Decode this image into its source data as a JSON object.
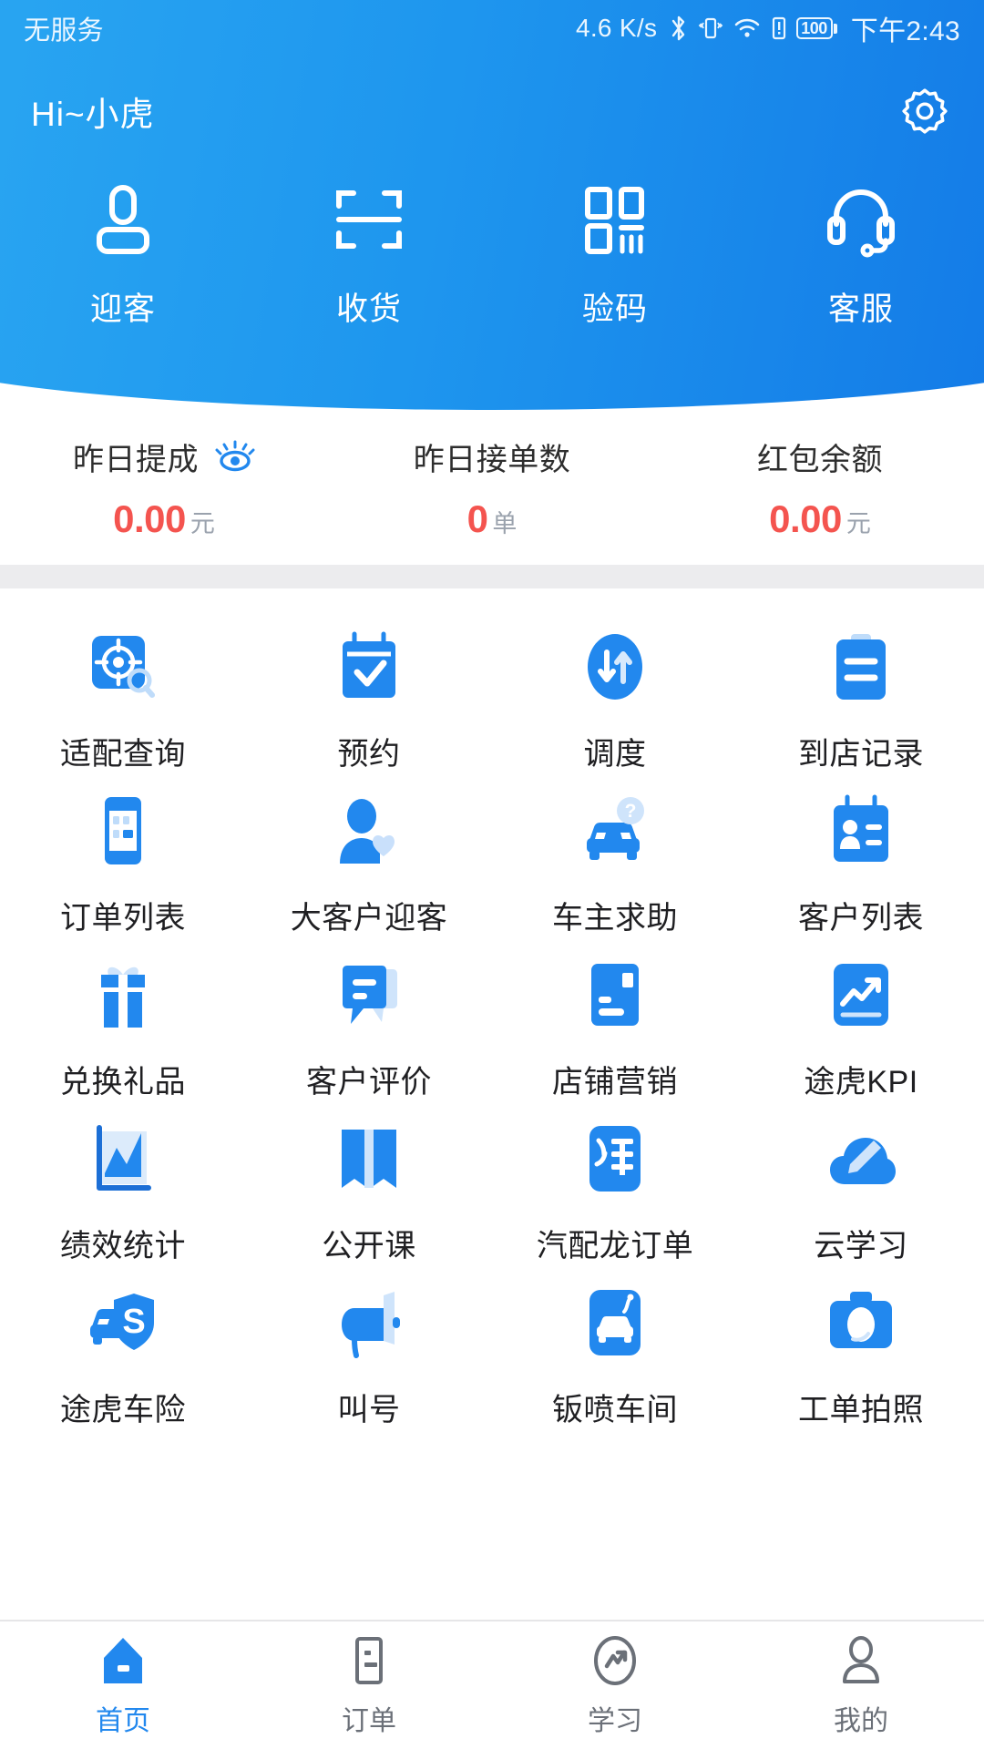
{
  "status_bar": {
    "carrier": "无服务",
    "net_speed": "4.6 K/s",
    "battery_level": "100",
    "time": "下午2:43",
    "icons": [
      "bluetooth-icon",
      "vibrate-icon",
      "wifi-icon",
      "sim-icon",
      "battery-icon"
    ]
  },
  "header": {
    "greeting": "Hi~小虎",
    "settings_icon": "gear-icon",
    "accent_light": "#2BA8F2",
    "accent_dark": "#1277E6",
    "quick_actions": [
      {
        "label": "迎客",
        "icon": "greeter-person-icon"
      },
      {
        "label": "收货",
        "icon": "scan-frame-icon"
      },
      {
        "label": "验码",
        "icon": "qr-code-icon"
      },
      {
        "label": "客服",
        "icon": "headset-icon"
      }
    ]
  },
  "stats": {
    "eye_icon": "eye-visible-icon",
    "value_color": "#F4544F",
    "items": [
      {
        "label": "昨日提成",
        "value": "0.00",
        "unit": "元",
        "has_eye": true
      },
      {
        "label": "昨日接单数",
        "value": "0",
        "unit": "单",
        "has_eye": false
      },
      {
        "label": "红包余额",
        "value": "0.00",
        "unit": "元",
        "has_eye": false
      }
    ]
  },
  "app_grid": {
    "rows": [
      [
        {
          "label": "适配查询",
          "icon": "target-search-icon"
        },
        {
          "label": "预约",
          "icon": "calendar-check-icon"
        },
        {
          "label": "调度",
          "icon": "dispatch-arrows-icon"
        },
        {
          "label": "到店记录",
          "icon": "clipboard-icon"
        }
      ],
      [
        {
          "label": "订单列表",
          "icon": "order-list-icon"
        },
        {
          "label": "大客户迎客",
          "icon": "vip-person-heart-icon"
        },
        {
          "label": "车主求助",
          "icon": "car-question-icon"
        },
        {
          "label": "客户列表",
          "icon": "id-card-icon"
        }
      ],
      [
        {
          "label": "兑换礼品",
          "icon": "gift-icon"
        },
        {
          "label": "客户评价",
          "icon": "comment-bubble-icon"
        },
        {
          "label": "店铺营销",
          "icon": "storefront-icon"
        },
        {
          "label": "途虎KPI",
          "icon": "trend-chart-icon"
        }
      ],
      [
        {
          "label": "绩效统计",
          "icon": "performance-chart-icon"
        },
        {
          "label": "公开课",
          "icon": "open-book-icon"
        },
        {
          "label": "汽配龙订单",
          "icon": "qi-parts-icon"
        },
        {
          "label": "云学习",
          "icon": "cloud-pencil-icon"
        }
      ],
      [
        {
          "label": "途虎车险",
          "icon": "car-insurance-shield-icon"
        },
        {
          "label": "叫号",
          "icon": "megaphone-icon"
        },
        {
          "label": "钣喷车间",
          "icon": "paint-workshop-icon"
        },
        {
          "label": "工单拍照",
          "icon": "camera-icon"
        }
      ]
    ]
  },
  "bottom_nav": {
    "active_color": "#2288EE",
    "inactive_color": "#6b7078",
    "items": [
      {
        "label": "首页",
        "icon": "home-icon",
        "active": true
      },
      {
        "label": "订单",
        "icon": "order-icon",
        "active": false
      },
      {
        "label": "学习",
        "icon": "study-icon",
        "active": false
      },
      {
        "label": "我的",
        "icon": "profile-icon",
        "active": false
      }
    ]
  }
}
